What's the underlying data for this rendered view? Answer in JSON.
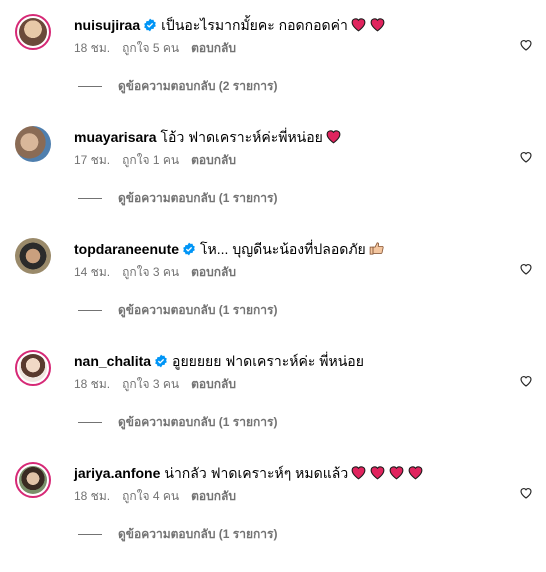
{
  "comments": [
    {
      "username": "nuisujiraa",
      "verified": true,
      "text": "เป็นอะไรมากมั้ยคะ กอดกอดค่า",
      "hearts": 2,
      "time": "18 ชม.",
      "likes": "ถูกใจ 5 คน",
      "reply_label": "ตอบกลับ",
      "view_replies": "ดูข้อความตอบกลับ (2 รายการ)"
    },
    {
      "username": "muayarisara",
      "verified": false,
      "text": "โอ้ว ฟาดเคราะห์ค่ะพี่หน่อย",
      "hearts": 1,
      "time": "17 ชม.",
      "likes": "ถูกใจ 1 คน",
      "reply_label": "ตอบกลับ",
      "view_replies": "ดูข้อความตอบกลับ (1 รายการ)"
    },
    {
      "username": "topdaraneenute",
      "verified": true,
      "text": "โห... บุญดีนะน้องที่ปลอดภัย",
      "thumbs": true,
      "hearts": 0,
      "time": "14 ชม.",
      "likes": "ถูกใจ 3 คน",
      "reply_label": "ตอบกลับ",
      "view_replies": "ดูข้อความตอบกลับ (1 รายการ)"
    },
    {
      "username": "nan_chalita",
      "verified": true,
      "text": "อูยยยยย ฟาดเคราะห์ค่ะ พี่หน่อย",
      "hearts": 0,
      "time": "18 ชม.",
      "likes": "ถูกใจ 3 คน",
      "reply_label": "ตอบกลับ",
      "view_replies": "ดูข้อความตอบกลับ (1 รายการ)"
    },
    {
      "username": "jariya.anfone",
      "verified": false,
      "text": "น่ากลัว ฟาดเคราะห์ๆ หมดแล้ว",
      "hearts": 4,
      "time": "18 ชม.",
      "likes": "ถูกใจ 4 คน",
      "reply_label": "ตอบกลับ",
      "view_replies": "ดูข้อความตอบกลับ (1 รายการ)"
    }
  ],
  "colors": {
    "heart": "#e0245e",
    "verified": "#0095f6",
    "secondary_text": "#737373",
    "story_ring": "#d62976"
  },
  "icons": {
    "like": "heart-outline-icon",
    "verified": "verified-badge-icon",
    "emoji_heart": "red-heart-emoji",
    "emoji_thumbs": "thumbs-up-emoji"
  }
}
